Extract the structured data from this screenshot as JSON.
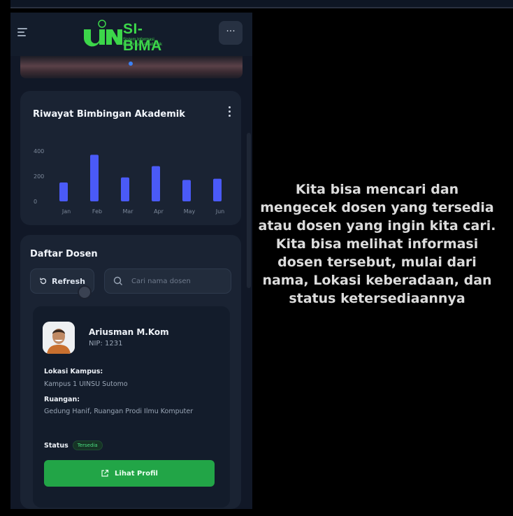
{
  "app": {
    "logo_title": "SI-BIMA",
    "logo_subtitle_1": "Sistem Informasi",
    "logo_subtitle_2": "Bimbingan Akademik",
    "logo_mark": "UIN"
  },
  "header": {
    "more_label": "···"
  },
  "colors": {
    "brand_green": "#3cd64a",
    "bar_blue": "#4a5af7",
    "button_green": "#22a547",
    "card_bg": "#1a2333"
  },
  "chart": {
    "title": "Riwayat Bimbingan Akademik"
  },
  "chart_data": {
    "type": "bar",
    "categories": [
      "Jan",
      "Feb",
      "Mar",
      "Apr",
      "May",
      "Jun"
    ],
    "values": [
      150,
      370,
      190,
      280,
      170,
      180
    ],
    "ylim": [
      0,
      400
    ],
    "yticks": [
      "400",
      "200",
      "0"
    ],
    "grid": false
  },
  "dosen": {
    "title": "Daftar Dosen",
    "refresh_label": "Refresh",
    "search_placeholder": "Cari nama dosen",
    "lecturer": {
      "name": "Ariusman M.Kom",
      "nip": "NIP: 1231",
      "campus_label": "Lokasi Kampus:",
      "campus_value": "Kampus 1 UINSU Sutomo",
      "room_label": "Ruangan:",
      "room_value": "Gedung Hanif, Ruangan Prodi Ilmu Komputer",
      "status_label": "Status",
      "status_value": "Tersedia",
      "profile_button": "Lihat Profil"
    }
  },
  "caption": "Kita bisa mencari dan\nmengecek dosen yang tersedia\natau dosen yang ingin kita cari.\nKita bisa melihat informasi\ndosen tersebut, mulai dari\nnama, Lokasi keberadaan, dan\nstatus ketersediaannya"
}
